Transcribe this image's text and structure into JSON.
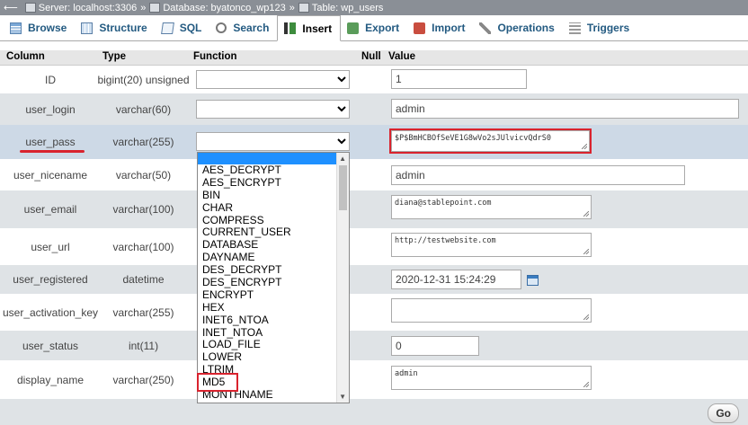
{
  "breadcrumb": {
    "server": "Server: localhost:3306",
    "database": "Database: byatonco_wp123",
    "table": "Table: wp_users",
    "sep": "»"
  },
  "tabs": [
    {
      "label": "Browse",
      "icon": "browse-icon"
    },
    {
      "label": "Structure",
      "icon": "structure-icon"
    },
    {
      "label": "SQL",
      "icon": "sql-icon"
    },
    {
      "label": "Search",
      "icon": "search-icon"
    },
    {
      "label": "Insert",
      "icon": "insert-icon",
      "active": true
    },
    {
      "label": "Export",
      "icon": "export-icon"
    },
    {
      "label": "Import",
      "icon": "import-icon"
    },
    {
      "label": "Operations",
      "icon": "operations-icon"
    },
    {
      "label": "Triggers",
      "icon": "triggers-icon"
    }
  ],
  "headers": {
    "column": "Column",
    "type": "Type",
    "function": "Function",
    "null": "Null",
    "value": "Value"
  },
  "rows": [
    {
      "column": "ID",
      "type": "bigint(20) unsigned",
      "value": "1"
    },
    {
      "column": "user_login",
      "type": "varchar(60)",
      "value": "admin"
    },
    {
      "column": "user_pass",
      "type": "varchar(255)",
      "value": "$P$BmHCBOfSeVE1G8wVo2sJUlvicvQdrS0"
    },
    {
      "column": "user_nicename",
      "type": "varchar(50)",
      "value": "admin"
    },
    {
      "column": "user_email",
      "type": "varchar(100)",
      "value": "diana@stablepoint.com"
    },
    {
      "column": "user_url",
      "type": "varchar(100)",
      "value": "http://testwebsite.com"
    },
    {
      "column": "user_registered",
      "type": "datetime",
      "value": "2020-12-31 15:24:29"
    },
    {
      "column": "user_activation_key",
      "type": "varchar(255)",
      "value": ""
    },
    {
      "column": "user_status",
      "type": "int(11)",
      "value": "0"
    },
    {
      "column": "display_name",
      "type": "varchar(250)",
      "value": "admin"
    }
  ],
  "function_options": [
    "AES_DECRYPT",
    "AES_ENCRYPT",
    "BIN",
    "CHAR",
    "COMPRESS",
    "CURRENT_USER",
    "DATABASE",
    "DAYNAME",
    "DES_DECRYPT",
    "DES_ENCRYPT",
    "ENCRYPT",
    "HEX",
    "INET6_NTOA",
    "INET_NTOA",
    "LOAD_FILE",
    "LOWER",
    "LTRIM",
    "MD5",
    "MONTHNAME"
  ],
  "go_label": "Go",
  "colors": {
    "highlight": "#d9232e",
    "selected_option": "#1e90ff",
    "tab_text": "#235a81"
  }
}
